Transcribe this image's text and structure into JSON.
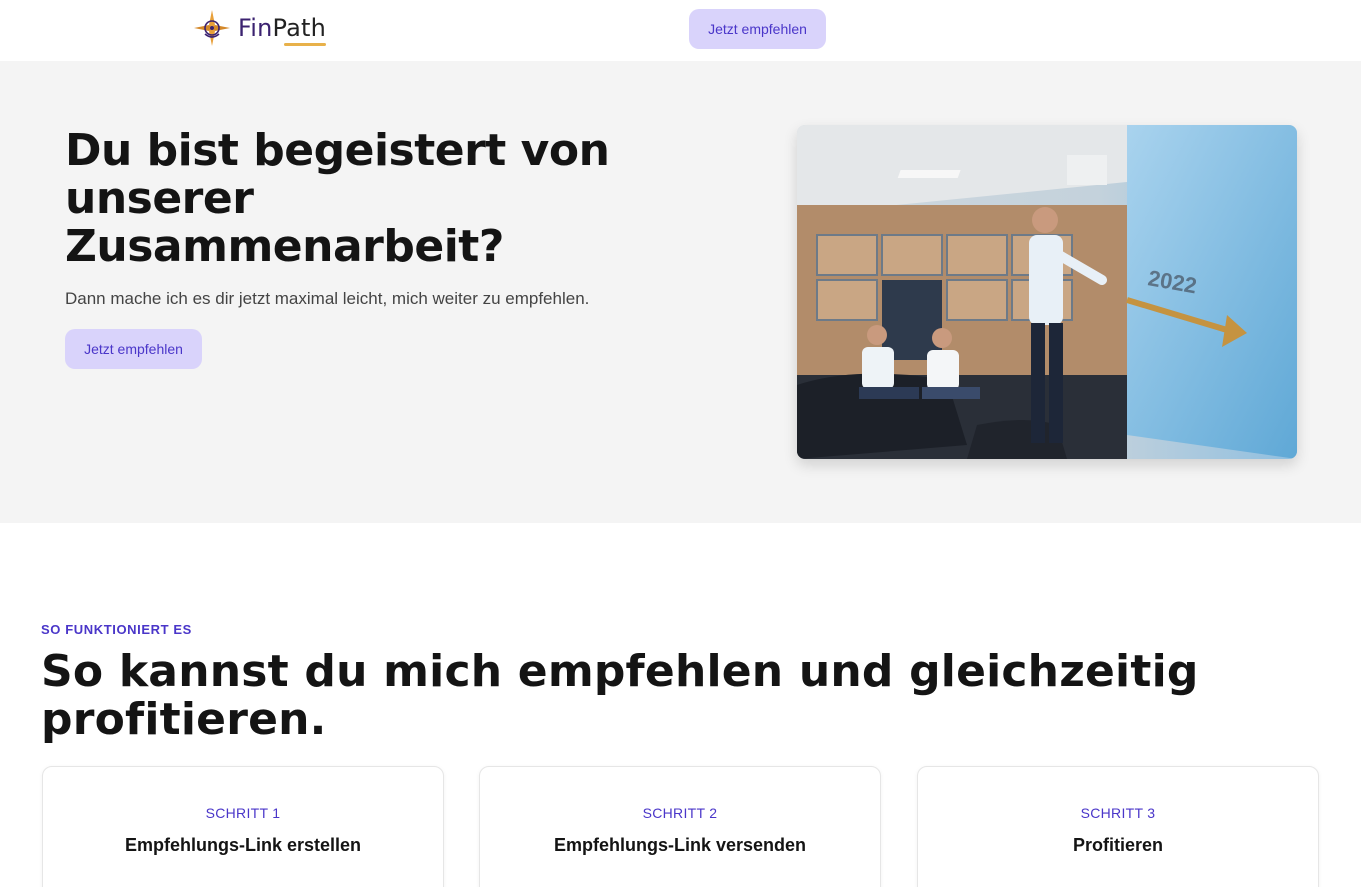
{
  "brand": {
    "name_prefix": "Fin",
    "name_suffix": "Path",
    "accent_color": "#e8b14a",
    "primary_color": "#4a36c9",
    "button_bg": "#d9d3fb"
  },
  "header": {
    "cta_label": "Jetzt empfehlen"
  },
  "hero": {
    "title": "Du bist begeistert von unserer Zusammenarbeit?",
    "subtitle": "Dann mache ich es dir jetzt maximal leicht, mich weiter zu empfehlen.",
    "cta_label": "Jetzt empfehlen",
    "image_text": "2022"
  },
  "steps": {
    "eyebrow": "SO FUNKTIONIERT ES",
    "title": "So kannst du mich empfehlen und gleichzeitig profitieren.",
    "items": [
      {
        "step": "SCHRITT 1",
        "title": "Empfehlungs-Link erstellen"
      },
      {
        "step": "SCHRITT 2",
        "title": "Empfehlungs-Link versenden"
      },
      {
        "step": "SCHRITT 3",
        "title": "Profitieren"
      }
    ]
  }
}
